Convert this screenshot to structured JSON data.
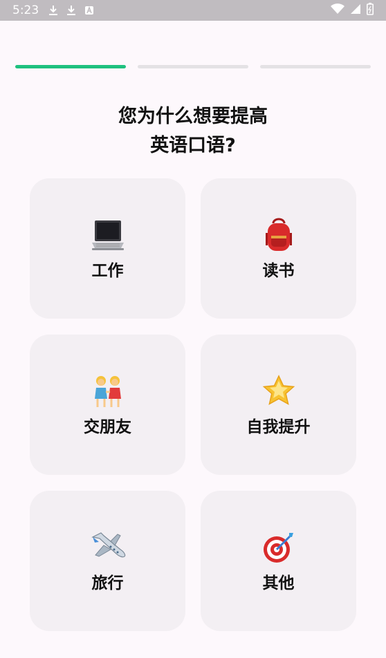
{
  "status_bar": {
    "time": "5:23"
  },
  "progress": {
    "total_steps": 3,
    "current_step": 1
  },
  "question": {
    "line1": "您为什么想要提高",
    "line2": "英语口语?"
  },
  "options": [
    {
      "label": "工作",
      "icon": "laptop-icon"
    },
    {
      "label": "读书",
      "icon": "backpack-icon"
    },
    {
      "label": "交朋友",
      "icon": "friends-icon"
    },
    {
      "label": "自我提升",
      "icon": "star-icon"
    },
    {
      "label": "旅行",
      "icon": "airplane-icon"
    },
    {
      "label": "其他",
      "icon": "target-icon"
    }
  ],
  "colors": {
    "accent": "#1fc17f",
    "card_bg": "#f3eff3",
    "page_bg": "#fdf8fc"
  }
}
